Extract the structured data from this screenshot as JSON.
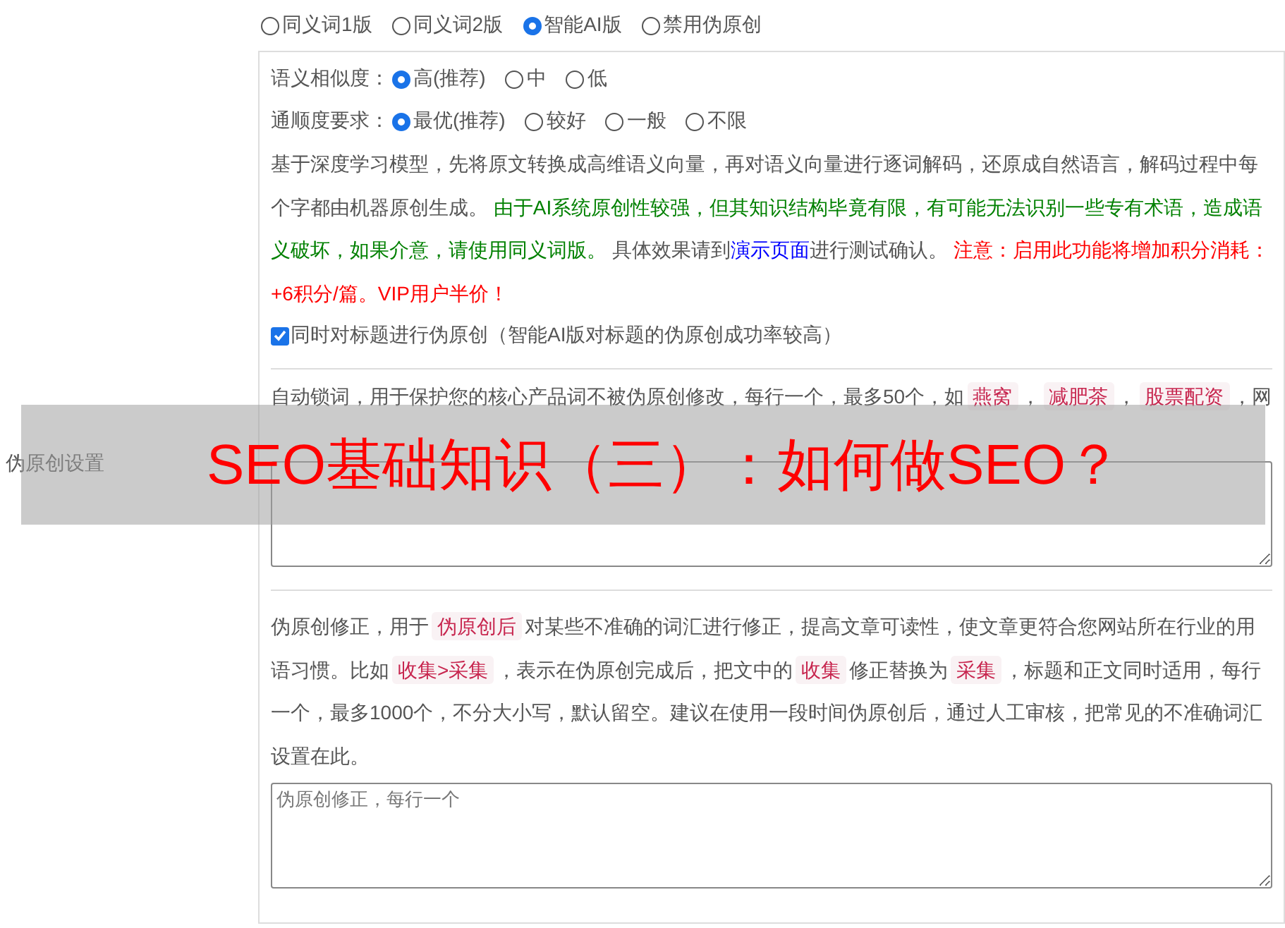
{
  "section_label": "伪原创设置",
  "modes": [
    {
      "label": "同义词1版",
      "selected": false
    },
    {
      "label": "同义词2版",
      "selected": false
    },
    {
      "label": "智能AI版",
      "selected": true
    },
    {
      "label": "禁用伪原创",
      "selected": false
    }
  ],
  "similarity": {
    "label": "语义相似度：",
    "options": [
      {
        "label": "高(推荐)",
        "selected": true
      },
      {
        "label": "中",
        "selected": false
      },
      {
        "label": "低",
        "selected": false
      }
    ]
  },
  "fluency": {
    "label": "通顺度要求：",
    "options": [
      {
        "label": "最优(推荐)",
        "selected": true
      },
      {
        "label": "较好",
        "selected": false
      },
      {
        "label": "一般",
        "selected": false
      },
      {
        "label": "不限",
        "selected": false
      }
    ]
  },
  "ai_description": [
    {
      "kind": "plain",
      "text": "基于深度学习模型，先将原文转换成高维语义向量，再对语义向量进行逐词解码，还原成自然语言，解码过程中每个字都由机器原创生成。 "
    },
    {
      "kind": "green",
      "text": "由于AI系统原创性较强，但其知识结构毕竟有限，有可能无法识别一些专有术语，造成语义破坏，如果介意，请使用同义词版。"
    },
    {
      "kind": "plain",
      "text": " 具体效果请到"
    },
    {
      "kind": "link",
      "text": "演示页面"
    },
    {
      "kind": "plain",
      "text": "进行测试确认。 "
    },
    {
      "kind": "red",
      "text": "注意：启用此功能将增加积分消耗：+6积分/篇。VIP用户半价！"
    }
  ],
  "title_option": {
    "label": "同时对标题进行伪原创（智能AI版对标题的伪原创成功率较高）",
    "checked": true
  },
  "lock_words": [
    {
      "kind": "text",
      "text": "自动锁词，用于保护您的核心产品词不被伪原创修改，每行一个，最多50个，如"
    },
    {
      "kind": "tag",
      "text": "燕窝"
    },
    {
      "kind": "text",
      "text": "，"
    },
    {
      "kind": "tag",
      "text": "减肥茶"
    },
    {
      "kind": "text",
      "text": "，"
    },
    {
      "kind": "tag",
      "text": "股票配资"
    },
    {
      "kind": "text",
      "text": "，网"
    }
  ],
  "correction": [
    {
      "kind": "text",
      "text": "伪原创修正，用于"
    },
    {
      "kind": "tag",
      "text": "伪原创后"
    },
    {
      "kind": "text",
      "text": "对某些不准确的词汇进行修正，提高文章可读性，使文章更符合您网站所在行业的用语习惯。比如"
    },
    {
      "kind": "tag",
      "text": "收集>采集"
    },
    {
      "kind": "text",
      "text": "，表示在伪原创完成后，把文中的"
    },
    {
      "kind": "tag",
      "text": "收集"
    },
    {
      "kind": "text",
      "text": "修正替换为"
    },
    {
      "kind": "tag",
      "text": "采集"
    },
    {
      "kind": "text",
      "text": "，标题和正文同时适用，每行一个，最多1000个，不分大小写，默认留空。建议在使用一段时间伪原创后，通过人工审核，把常见的不准确词汇设置在此。"
    }
  ],
  "correction_field": {
    "placeholder": "伪原创修正，每行一个"
  },
  "banner": {
    "title": "SEO基础知识（三）：如何做SEO？"
  }
}
